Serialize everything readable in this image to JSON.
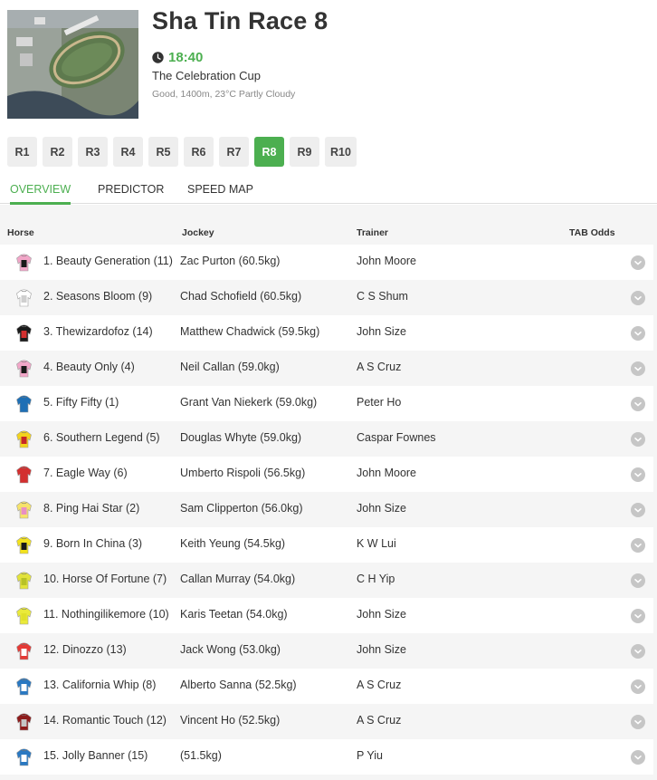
{
  "race": {
    "title": "Sha Tin Race 8",
    "time": "18:40",
    "name": "The Celebration Cup",
    "meta": "Good, 1400m, 23°C Partly Cloudy",
    "time_color": "#4caf50"
  },
  "race_tabs": [
    {
      "label": "R1",
      "active": false
    },
    {
      "label": "R2",
      "active": false
    },
    {
      "label": "R3",
      "active": false
    },
    {
      "label": "R4",
      "active": false
    },
    {
      "label": "R5",
      "active": false
    },
    {
      "label": "R6",
      "active": false
    },
    {
      "label": "R7",
      "active": false
    },
    {
      "label": "R8",
      "active": true
    },
    {
      "label": "R9",
      "active": false
    },
    {
      "label": "R10",
      "active": false
    }
  ],
  "view_tabs": [
    {
      "label": "OVERVIEW",
      "active": true
    },
    {
      "label": "PREDICTOR",
      "active": false
    },
    {
      "label": "SPEED MAP",
      "active": false
    }
  ],
  "table": {
    "headers": {
      "horse": "Horse",
      "jockey": "Jockey",
      "trainer": "Trainer",
      "odds": "TAB Odds"
    },
    "rows": [
      {
        "horse": "1. Beauty Generation (11)",
        "jockey": "Zac Purton (60.5kg)",
        "trainer": "John Moore",
        "silk": "pink-black",
        "expand_icon": "chevron-down-icon"
      },
      {
        "horse": "2. Seasons Bloom (9)",
        "jockey": "Chad Schofield (60.5kg)",
        "trainer": "C S Shum",
        "silk": "white",
        "expand_icon": "chevron-down-icon"
      },
      {
        "horse": "3. Thewizardofoz (14)",
        "jockey": "Matthew Chadwick (59.5kg)",
        "trainer": "John Size",
        "silk": "black-red",
        "expand_icon": "chevron-down-icon"
      },
      {
        "horse": "4. Beauty Only (4)",
        "jockey": "Neil Callan (59.0kg)",
        "trainer": "A S Cruz",
        "silk": "pink-black",
        "expand_icon": "chevron-down-icon"
      },
      {
        "horse": "5. Fifty Fifty (1)",
        "jockey": "Grant Van Niekerk (59.0kg)",
        "trainer": "Peter Ho",
        "silk": "blue",
        "expand_icon": "chevron-down-icon"
      },
      {
        "horse": "6. Southern Legend (5)",
        "jockey": "Douglas Whyte (59.0kg)",
        "trainer": "Caspar Fownes",
        "silk": "yellow-red",
        "expand_icon": "chevron-down-icon"
      },
      {
        "horse": "7. Eagle Way (6)",
        "jockey": "Umberto Rispoli (56.5kg)",
        "trainer": "John Moore",
        "silk": "red",
        "expand_icon": "chevron-down-icon"
      },
      {
        "horse": "8. Ping Hai Star (2)",
        "jockey": "Sam Clipperton (56.0kg)",
        "trainer": "John Size",
        "silk": "yellow-pink",
        "expand_icon": "chevron-down-icon"
      },
      {
        "horse": "9. Born In China (3)",
        "jockey": "Keith Yeung (54.5kg)",
        "trainer": "K W Lui",
        "silk": "yellow-black",
        "expand_icon": "chevron-down-icon"
      },
      {
        "horse": "10. Horse Of Fortune (7)",
        "jockey": "Callan Murray (54.0kg)",
        "trainer": "C H Yip",
        "silk": "yellow-green",
        "expand_icon": "chevron-down-icon"
      },
      {
        "horse": "11. Nothingilikemore (10)",
        "jockey": "Karis Teetan (54.0kg)",
        "trainer": "John Size",
        "silk": "yellow",
        "expand_icon": "chevron-down-icon"
      },
      {
        "horse": "12. Dinozzo (13)",
        "jockey": "Jack Wong (53.0kg)",
        "trainer": "John Size",
        "silk": "red-white",
        "expand_icon": "chevron-down-icon"
      },
      {
        "horse": "13. California Whip (8)",
        "jockey": "Alberto Sanna (52.5kg)",
        "trainer": "A S Cruz",
        "silk": "blue-white",
        "expand_icon": "chevron-down-icon"
      },
      {
        "horse": "14. Romantic Touch (12)",
        "jockey": "Vincent Ho (52.5kg)",
        "trainer": "A S Cruz",
        "silk": "maroon",
        "expand_icon": "chevron-down-icon"
      },
      {
        "horse": "15. Jolly Banner (15)",
        "jockey": "(51.5kg)",
        "trainer": "P Yiu",
        "silk": "blue-white",
        "expand_icon": "chevron-down-icon"
      }
    ]
  },
  "silk_colors": {
    "pink-black": [
      "#f2a6c8",
      "#1a1a1a"
    ],
    "white": [
      "#ffffff",
      "#cfcfcf"
    ],
    "black-red": [
      "#1a1a1a",
      "#d32f2f"
    ],
    "blue": [
      "#1e6fb5",
      "#1e6fb5"
    ],
    "yellow-red": [
      "#f3d31c",
      "#c62828"
    ],
    "red": [
      "#d32f2f",
      "#d32f2f"
    ],
    "yellow-pink": [
      "#f6e36a",
      "#e88fc4"
    ],
    "yellow-black": [
      "#f3e21c",
      "#1a1a1a"
    ],
    "yellow-green": [
      "#e2e33a",
      "#b8c227"
    ],
    "yellow": [
      "#eaea3a",
      "#e0e02a"
    ],
    "red-white": [
      "#e53935",
      "#ffffff"
    ],
    "blue-white": [
      "#2978c2",
      "#ffffff"
    ],
    "maroon": [
      "#8e1b1b",
      "#c6c6c6"
    ]
  }
}
